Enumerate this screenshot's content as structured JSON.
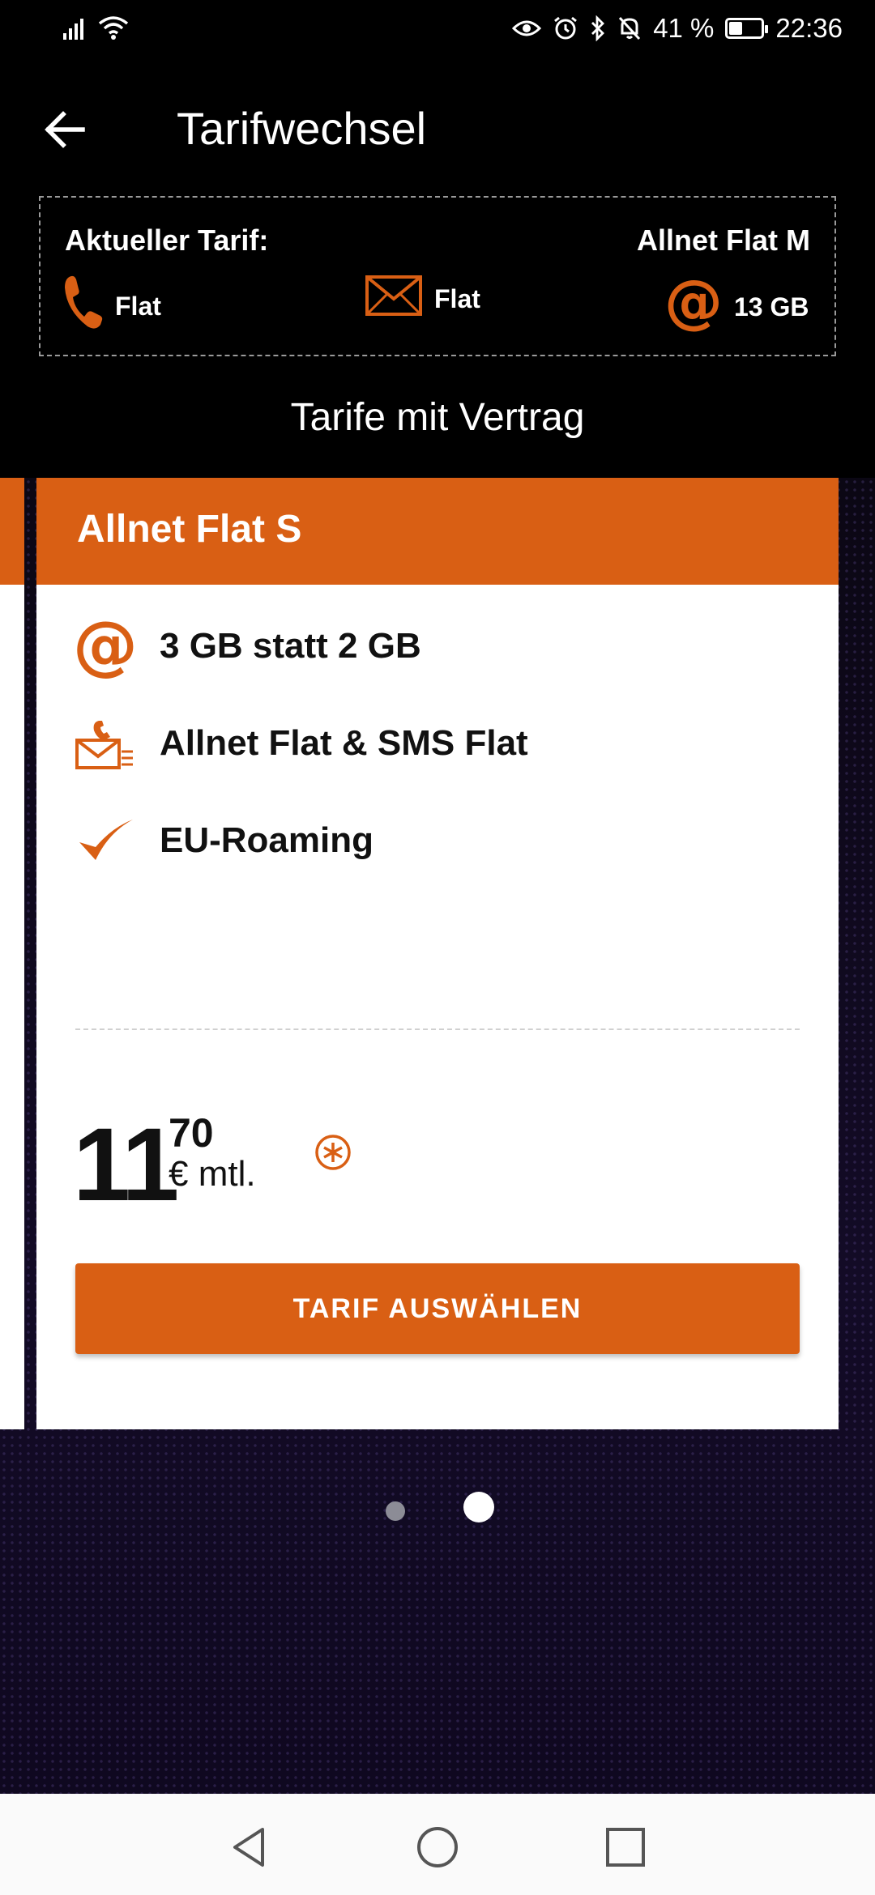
{
  "status_bar": {
    "battery_percent": "41 %",
    "battery_level": 0.41,
    "time": "22:36",
    "icons": [
      "signal-icon",
      "wifi-icon",
      "eye-icon",
      "alarm-icon",
      "bluetooth-icon",
      "mute-icon",
      "battery-icon"
    ]
  },
  "app_bar": {
    "title": "Tarifwechsel",
    "back_icon": "arrow-left-icon"
  },
  "current_tariff": {
    "label": "Aktueller Tarif:",
    "name": "Allnet Flat M",
    "features": [
      {
        "icon": "phone-icon",
        "text": "Flat"
      },
      {
        "icon": "mail-icon",
        "text": "Flat"
      },
      {
        "icon": "at-icon",
        "text": "13 GB"
      }
    ]
  },
  "section": {
    "title": "Tarife mit Vertrag"
  },
  "tariff_card": {
    "name": "Allnet Flat S",
    "features": [
      {
        "icon": "at-icon",
        "text": "3 GB statt 2 GB"
      },
      {
        "icon": "mail-phone-icon",
        "text": "Allnet Flat & SMS Flat"
      },
      {
        "icon": "check-icon",
        "text": "EU-Roaming"
      }
    ],
    "price_integer": "11",
    "price_decimal": "70",
    "price_unit": "€ mtl.",
    "footnote_icon": "asterisk-circle-icon",
    "cta_label": "TARIF AUSWÄHLEN"
  },
  "pagination": {
    "pages": 2,
    "active_index": 1
  },
  "nav_bar": {
    "buttons": [
      "back-triangle-icon",
      "home-circle-icon",
      "recents-square-icon"
    ]
  },
  "colors": {
    "accent": "#d95f14",
    "background": "#000000",
    "card": "#ffffff"
  }
}
